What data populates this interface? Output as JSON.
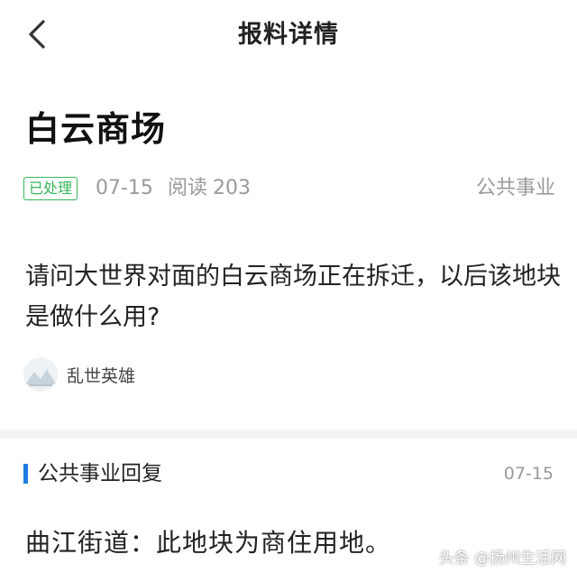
{
  "nav": {
    "title": "报料详情",
    "back_icon": "chevron-left-icon"
  },
  "post": {
    "title": "白云商场",
    "status": "已处理",
    "date": "07-15",
    "reads_label": "阅读",
    "reads_count": "203",
    "category": "公共事业",
    "body": "请问大世界对面的白云商场正在拆迁，以后该地块是做什么用?",
    "author": "乱世英雄"
  },
  "reply": {
    "title": "公共事业回复",
    "date": "07-15",
    "body": "曲江街道：此地块为商住用地。"
  },
  "watermark": "头条 @扬州生活网",
  "colors": {
    "status_green": "#34b65a",
    "accent_blue": "#1f7de0",
    "muted": "#9a9a9a"
  }
}
